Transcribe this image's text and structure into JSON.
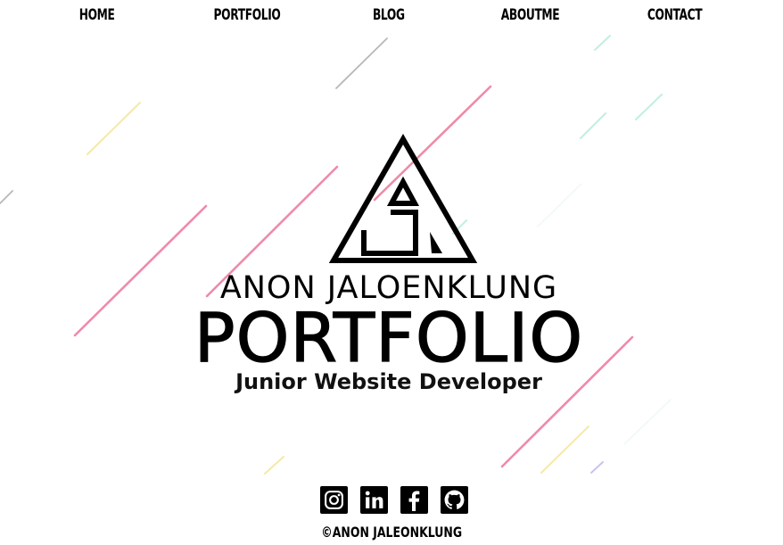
{
  "nav": {
    "items": [
      {
        "label": "HOME"
      },
      {
        "label": "PORTFOLIO"
      },
      {
        "label": "BLOG"
      },
      {
        "label": "ABOUTME"
      },
      {
        "label": "CONTACT"
      }
    ]
  },
  "hero": {
    "logo_icon": "triangle-monogram-icon",
    "name": "ANON JALOENKLUNG",
    "title": "PORTFOLIO",
    "subtitle": "Junior Website Developer"
  },
  "social": {
    "icons": [
      "instagram-icon",
      "linkedin-icon",
      "facebook-icon",
      "github-icon"
    ]
  },
  "footer": {
    "copyright": "©ANON JALEONKLUNG"
  },
  "colors": {
    "text": "#000000",
    "background": "#ffffff",
    "accent_pink": "#f08aa8",
    "accent_yellow": "#f5e9a6",
    "accent_teal": "#bff0e2",
    "accent_gray": "#b8b8b8",
    "accent_purple": "#c9c2f0"
  }
}
